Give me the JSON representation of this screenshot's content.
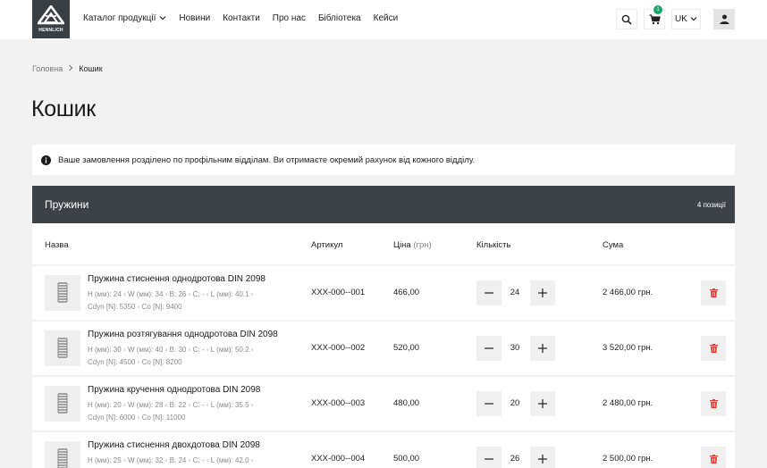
{
  "header": {
    "logo_text": "HENNLICH",
    "nav": [
      {
        "label": "Каталог продукції",
        "has_dropdown": true
      },
      {
        "label": "Новини"
      },
      {
        "label": "Контакти"
      },
      {
        "label": "Про нас"
      },
      {
        "label": "Бібліотека"
      },
      {
        "label": "Кейси"
      }
    ],
    "cart_count": "1",
    "language": "UK"
  },
  "breadcrumb": {
    "home": "Головна",
    "current": "Кошик"
  },
  "page_title": "Кошик",
  "notice": "Ваше замовлення розділено по профільним відділам. Ви отримаєте окремий рахунок від кожного відділу.",
  "group": {
    "title": "Пружини",
    "count": "4 позиції",
    "columns": {
      "name": "Назва",
      "sku": "Артикул",
      "price": "Ціна",
      "price_unit": "(грн)",
      "qty": "Кількість",
      "sum": "Сума"
    },
    "rows": [
      {
        "name": "Пружина стиснення однодротова DIN 2098",
        "spec1": "H (мм): 24 ◦ W (мм): 34 ◦ B: 26 ◦ C: - ◦ L (мм): 40.1 ◦",
        "spec2": "Cdyn [N]: 5350 ◦ Co [N]: 9400",
        "sku": "XXX-000--001",
        "price": "466,00",
        "qty": "24",
        "sum": "2 466,00 грн."
      },
      {
        "name": "Пружина розтягування однодротова DIN 2098",
        "spec1": "H (мм): 30 ◦ W (мм): 40 ◦ B: 30 ◦ C: - ◦ L (мм): 50.2 ◦",
        "spec2": "Cdyn [N]: 4500 ◦ Co [N]: 8200",
        "sku": "XXX-000--002",
        "price": "520,00",
        "qty": "30",
        "sum": "3 520,00 грн."
      },
      {
        "name": "Пружина кручення однодротова DIN 2098",
        "spec1": "H (мм): 20 ◦ W (мм): 28 ◦ B: 22 ◦ C: - ◦ L (мм): 35.5 ◦",
        "spec2": "Cdyn [N]: 6000 ◦ Co [N]: 11000",
        "sku": "XXX-000--003",
        "price": "480,00",
        "qty": "20",
        "sum": "2 480,00 грн."
      },
      {
        "name": "Пружина стиснення двохдотова DIN 2098",
        "spec1": "H (мм): 25 ◦ W (мм): 32 ◦ B: 24 ◦ C: - ◦ L (мм): 42.0 ◦",
        "spec2": "",
        "sku": "XXX-000--004",
        "price": "500,00",
        "qty": "26",
        "sum": "2 500,00 грн."
      }
    ]
  },
  "colors": {
    "header_dark": "#3d4247",
    "badge": "#1aa36b",
    "delete": "#e0403a",
    "background": "#f2f2f2"
  }
}
